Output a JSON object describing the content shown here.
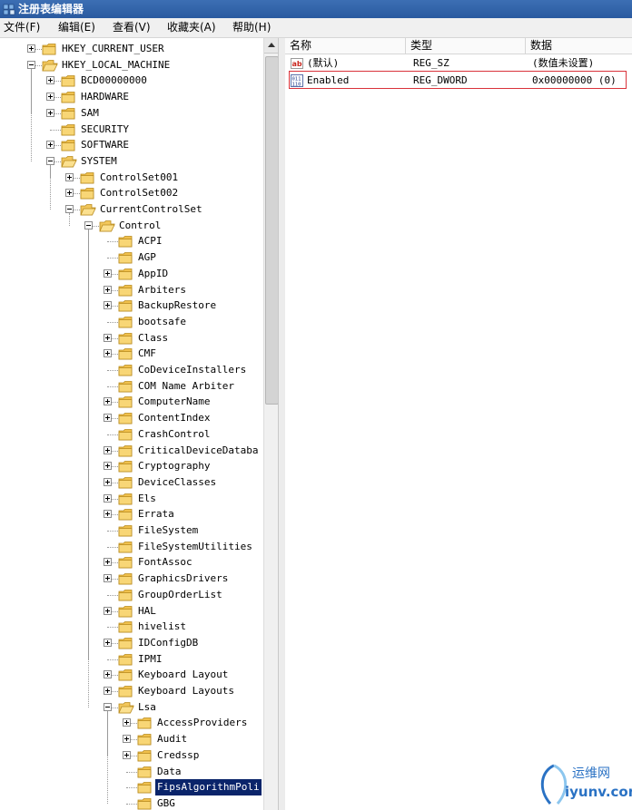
{
  "window": {
    "title": "注册表编辑器"
  },
  "menu": [
    "文件(F)",
    "编辑(E)",
    "查看(V)",
    "收藏夹(A)",
    "帮助(H)"
  ],
  "tree": {
    "nodes": [
      {
        "label": "HKEY_CURRENT_USER",
        "level": 0,
        "state": "collapsed"
      },
      {
        "label": "HKEY_LOCAL_MACHINE",
        "level": 0,
        "state": "expanded"
      },
      {
        "label": "BCD00000000",
        "level": 1,
        "state": "collapsed"
      },
      {
        "label": "HARDWARE",
        "level": 1,
        "state": "collapsed"
      },
      {
        "label": "SAM",
        "level": 1,
        "state": "collapsed"
      },
      {
        "label": "SECURITY",
        "level": 1,
        "state": "none"
      },
      {
        "label": "SOFTWARE",
        "level": 1,
        "state": "collapsed"
      },
      {
        "label": "SYSTEM",
        "level": 1,
        "state": "expanded"
      },
      {
        "label": "ControlSet001",
        "level": 2,
        "state": "collapsed"
      },
      {
        "label": "ControlSet002",
        "level": 2,
        "state": "collapsed"
      },
      {
        "label": "CurrentControlSet",
        "level": 2,
        "state": "expanded"
      },
      {
        "label": "Control",
        "level": 3,
        "state": "expanded"
      },
      {
        "label": "ACPI",
        "level": 4,
        "state": "none"
      },
      {
        "label": "AGP",
        "level": 4,
        "state": "none"
      },
      {
        "label": "AppID",
        "level": 4,
        "state": "collapsed"
      },
      {
        "label": "Arbiters",
        "level": 4,
        "state": "collapsed"
      },
      {
        "label": "BackupRestore",
        "level": 4,
        "state": "collapsed"
      },
      {
        "label": "bootsafe",
        "level": 4,
        "state": "none"
      },
      {
        "label": "Class",
        "level": 4,
        "state": "collapsed"
      },
      {
        "label": "CMF",
        "level": 4,
        "state": "collapsed"
      },
      {
        "label": "CoDeviceInstallers",
        "level": 4,
        "state": "none"
      },
      {
        "label": "COM Name Arbiter",
        "level": 4,
        "state": "none"
      },
      {
        "label": "ComputerName",
        "level": 4,
        "state": "collapsed"
      },
      {
        "label": "ContentIndex",
        "level": 4,
        "state": "collapsed"
      },
      {
        "label": "CrashControl",
        "level": 4,
        "state": "none"
      },
      {
        "label": "CriticalDeviceDataba",
        "level": 4,
        "state": "collapsed"
      },
      {
        "label": "Cryptography",
        "level": 4,
        "state": "collapsed"
      },
      {
        "label": "DeviceClasses",
        "level": 4,
        "state": "collapsed"
      },
      {
        "label": "Els",
        "level": 4,
        "state": "collapsed"
      },
      {
        "label": "Errata",
        "level": 4,
        "state": "collapsed"
      },
      {
        "label": "FileSystem",
        "level": 4,
        "state": "none"
      },
      {
        "label": "FileSystemUtilities",
        "level": 4,
        "state": "none"
      },
      {
        "label": "FontAssoc",
        "level": 4,
        "state": "collapsed"
      },
      {
        "label": "GraphicsDrivers",
        "level": 4,
        "state": "collapsed"
      },
      {
        "label": "GroupOrderList",
        "level": 4,
        "state": "none"
      },
      {
        "label": "HAL",
        "level": 4,
        "state": "collapsed"
      },
      {
        "label": "hivelist",
        "level": 4,
        "state": "none"
      },
      {
        "label": "IDConfigDB",
        "level": 4,
        "state": "collapsed"
      },
      {
        "label": "IPMI",
        "level": 4,
        "state": "none"
      },
      {
        "label": "Keyboard Layout",
        "level": 4,
        "state": "collapsed"
      },
      {
        "label": "Keyboard Layouts",
        "level": 4,
        "state": "collapsed"
      },
      {
        "label": "Lsa",
        "level": 4,
        "state": "expanded"
      },
      {
        "label": "AccessProviders",
        "level": 5,
        "state": "collapsed"
      },
      {
        "label": "Audit",
        "level": 5,
        "state": "collapsed"
      },
      {
        "label": "Credssp",
        "level": 5,
        "state": "collapsed"
      },
      {
        "label": "Data",
        "level": 5,
        "state": "none"
      },
      {
        "label": "FipsAlgorithmPoli",
        "level": 5,
        "state": "none",
        "selected": true
      },
      {
        "label": "GBG",
        "level": 5,
        "state": "none"
      }
    ]
  },
  "list": {
    "columns": [
      "名称",
      "类型",
      "数据"
    ],
    "rows": [
      {
        "icon": "string-value-icon",
        "name": "(默认)",
        "type": "REG_SZ",
        "data": "(数值未设置)"
      },
      {
        "icon": "binary-value-icon",
        "name": "Enabled",
        "type": "REG_DWORD",
        "data": "0x00000000 (0)"
      }
    ]
  },
  "watermark": {
    "cn": "运维网",
    "en": "iyunv.com"
  },
  "colors": {
    "selection": "#0a246a",
    "highlight_border": "#d9323a",
    "folder": "#e8b43c"
  }
}
